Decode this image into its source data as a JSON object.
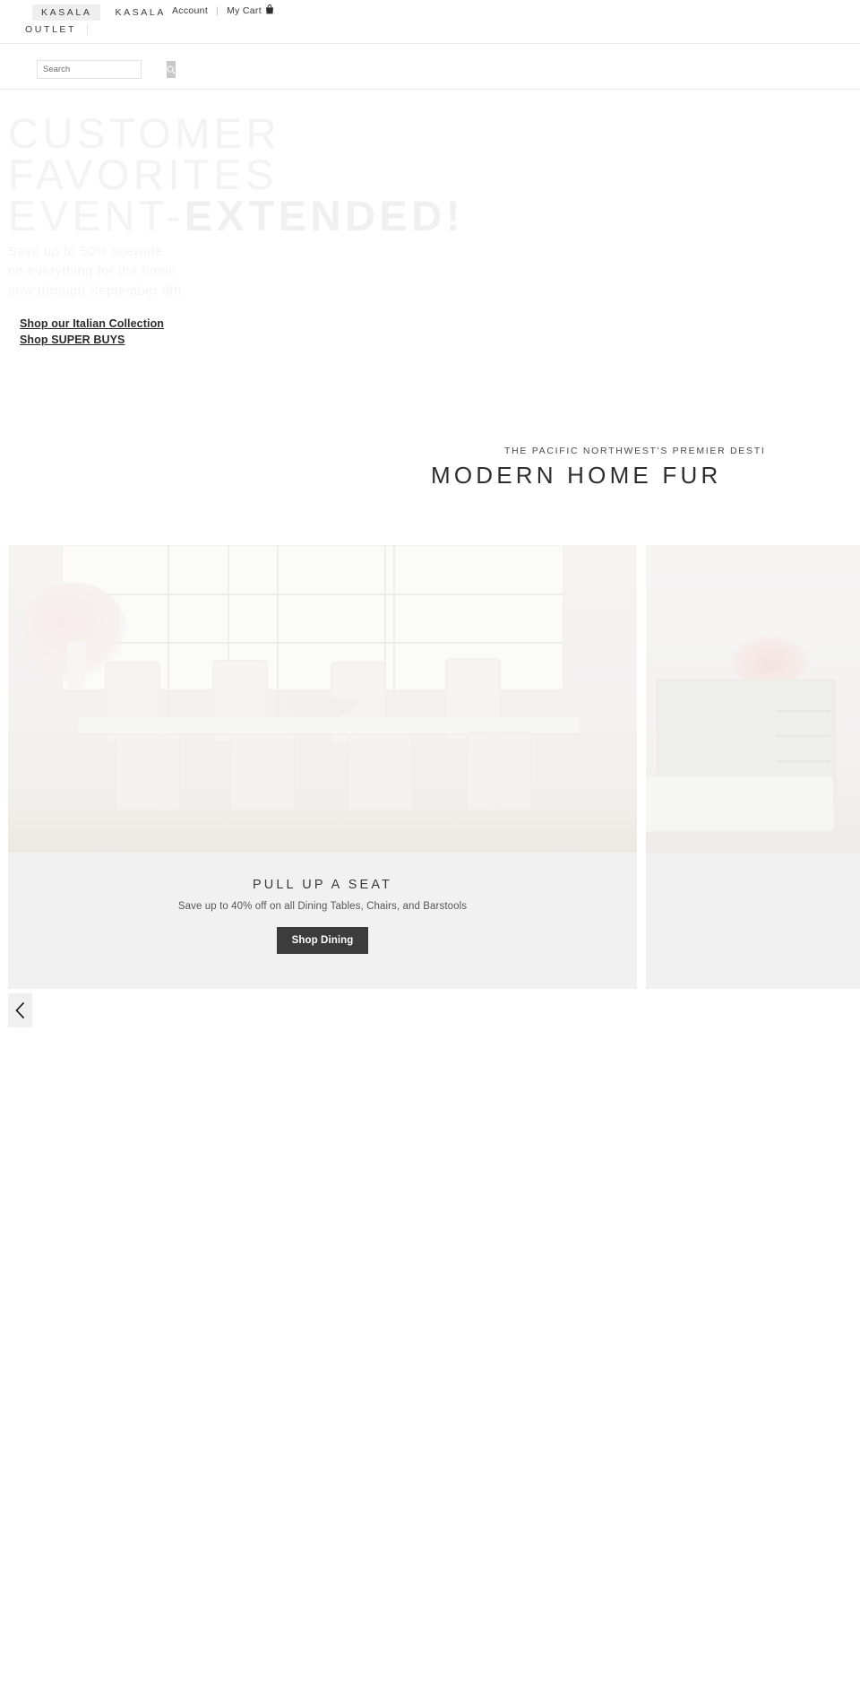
{
  "topbar": {
    "brand_chip": "KASALA",
    "brand_plain": "KASALA",
    "brand_outlet": "OUTLET",
    "account_label": "Account",
    "separator": "|",
    "cart_label": "My Cart",
    "cart_icon": "shopping-bag-icon"
  },
  "search": {
    "placeholder": "Search",
    "value": "",
    "icon": "search-icon"
  },
  "hero": {
    "line1": "CUSTOMER",
    "line2": "FAVORITES",
    "line3_light": "EVENT-",
    "line3_bold": "EXTENDED!",
    "sub_line1": "Save up to 50% sitewide",
    "sub_line2": "on everything for the home",
    "sub_line3": "now through September 9th",
    "cta_primary": "Shop our Italian Collection",
    "cta_secondary": "Shop SUPER BUYS",
    "headline_color": "#f3f3f3",
    "cta_color": "#2b2b2b"
  },
  "tagline": {
    "eyebrow": "THE PACIFIC NORTHWEST'S PREMIER DESTI",
    "headline": "MODERN HOME FUR"
  },
  "carousel": {
    "prev_icon": "chevron-left-icon",
    "slides": [
      {
        "image": "dining-room-photo",
        "title": "PULL UP A SEAT",
        "subtitle": "Save up to 40% off on all Dining Tables, Chairs, and Barstools",
        "button_label": "Shop Dining",
        "button_color": "#3c3c3c",
        "background": "#f1f1f1"
      },
      {
        "image": "living-room-photo",
        "title": "",
        "subtitle": "",
        "button_label": "",
        "background": "#f1f1f1"
      }
    ]
  }
}
